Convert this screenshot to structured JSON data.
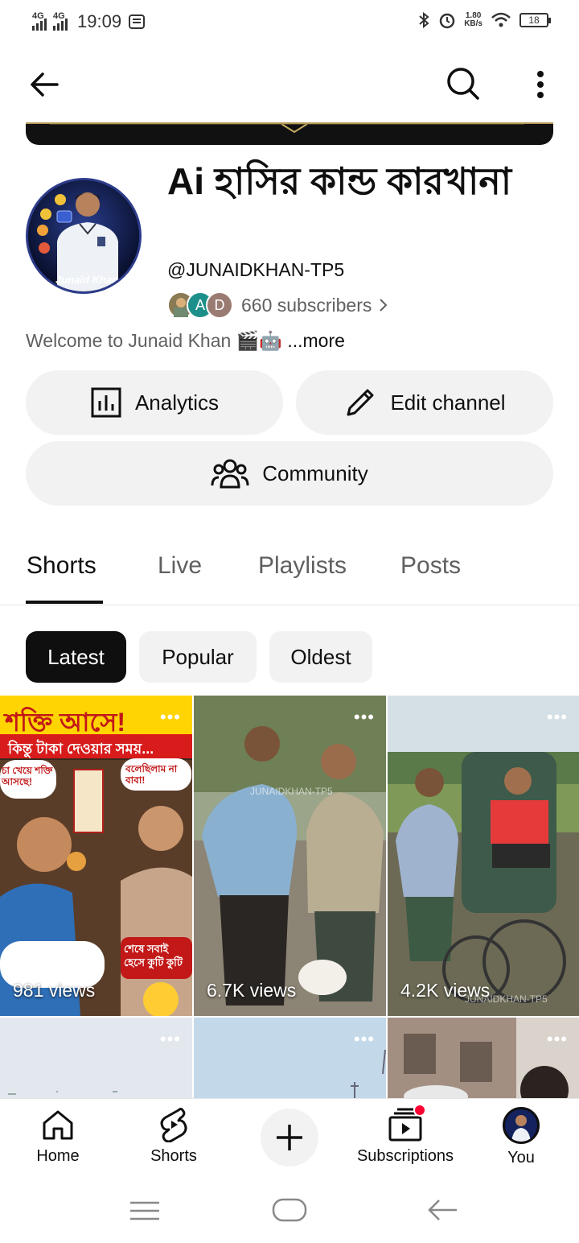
{
  "status": {
    "net1": "4G",
    "net2": "4G",
    "time": "19:09",
    "speed_value": "1.80",
    "speed_unit": "KB/s",
    "battery": "18"
  },
  "appbar": {
    "back_icon": "arrow-left-icon",
    "search_icon": "search-icon",
    "menu_icon": "more-vertical-icon"
  },
  "channel": {
    "title": "Ai হাসির কান্ড কারখানা",
    "handle": "@JUNAIDKHAN-TP5",
    "subscriber_avatars": [
      "",
      "A",
      "D"
    ],
    "subscribers": "660 subscribers",
    "description": "Welcome to Junaid Khan 🎬🤖",
    "more": " ...more",
    "avatar_caption": "Junaid Khan"
  },
  "actions": {
    "analytics": "Analytics",
    "edit_channel": "Edit channel",
    "community": "Community"
  },
  "tabs": [
    {
      "label": "Shorts",
      "active": true
    },
    {
      "label": "Live",
      "active": false
    },
    {
      "label": "Playlists",
      "active": false
    },
    {
      "label": "Posts",
      "active": false
    }
  ],
  "chips": [
    {
      "label": "Latest",
      "selected": true
    },
    {
      "label": "Popular",
      "selected": false
    },
    {
      "label": "Oldest",
      "selected": false
    }
  ],
  "shorts": [
    {
      "views": "981 views",
      "overlay_lines": [
        "শক্তি আসে!",
        "কিন্তু টাকা দেওয়ার সময়...",
        "চা খেয়ে শক্তি আসছে!",
        "বলেছিলাম না বাবা!",
        "শেষে সবাই হেসে কুটি কুটি"
      ]
    },
    {
      "views": "6.7K views",
      "watermark": "JUNAIDKHAN-TP5"
    },
    {
      "views": "4.2K views",
      "watermark": "JUNAIDKHAN-TP5"
    },
    {
      "views": ""
    },
    {
      "views": ""
    },
    {
      "views": ""
    }
  ],
  "bottom_nav": {
    "home": "Home",
    "shorts": "Shorts",
    "subscriptions": "Subscriptions",
    "you": "You"
  },
  "colors": {
    "text_primary": "#0f0f0f",
    "text_secondary": "#606060",
    "pill_bg": "#f2f2f2",
    "notification": "#ff0033"
  }
}
